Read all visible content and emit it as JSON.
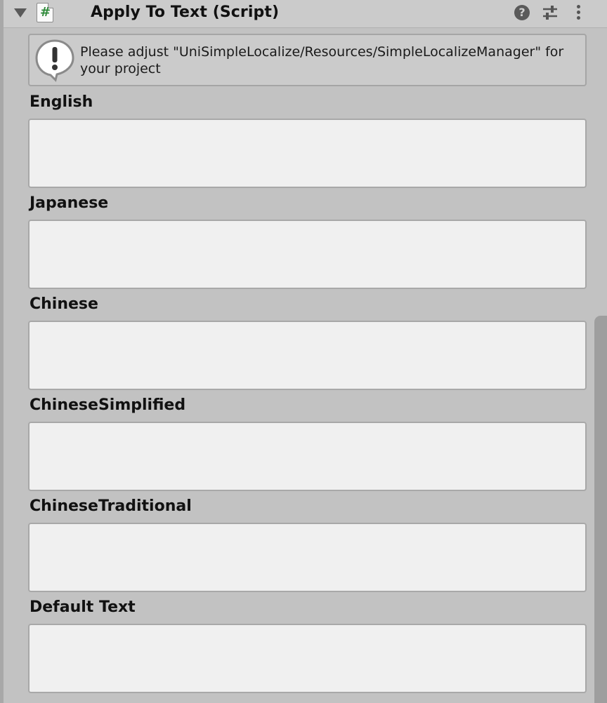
{
  "header": {
    "title": "Apply To Text (Script)",
    "script_icon_glyph": "#",
    "help_glyph": "?",
    "icons": [
      "foldout-arrow-icon",
      "script-icon",
      "help-icon",
      "presets-icon",
      "context-menu-icon"
    ]
  },
  "helpbox": {
    "message": "Please adjust \"UniSimpleLocalize/Resources/SimpleLocalizeManager\" for your project",
    "icon": "warning-icon"
  },
  "fields": [
    {
      "label": "English",
      "value": ""
    },
    {
      "label": "Japanese",
      "value": ""
    },
    {
      "label": "Chinese",
      "value": ""
    },
    {
      "label": "ChineseSimplified",
      "value": ""
    },
    {
      "label": "ChineseTraditional",
      "value": ""
    },
    {
      "label": "Default Text",
      "value": ""
    }
  ],
  "colors": {
    "background": "#c2c2c2",
    "field_background": "#f0f0f0",
    "script_hash": "#2f8a3a"
  }
}
